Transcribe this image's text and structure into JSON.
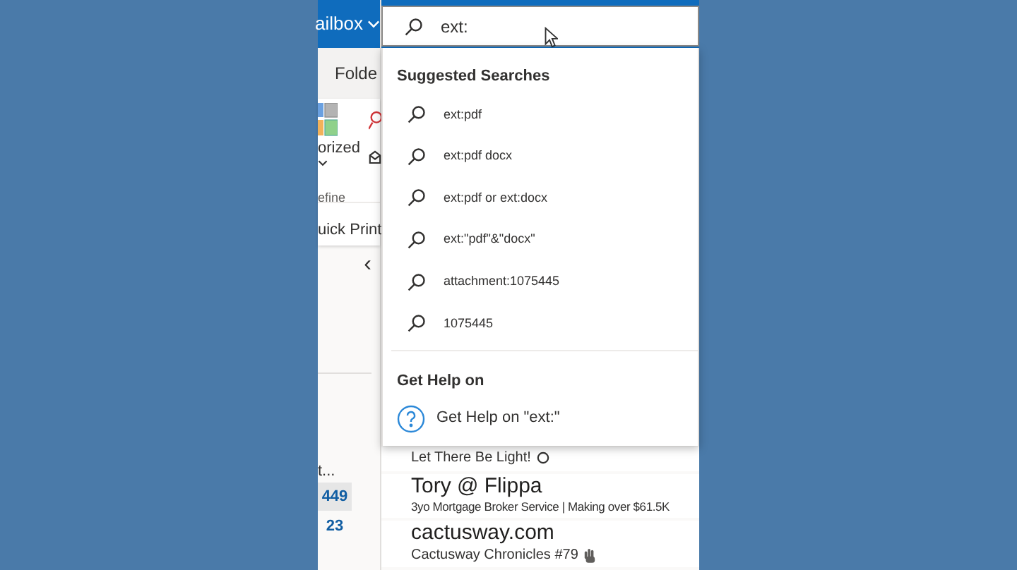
{
  "header": {
    "mailbox_label": "ailbox"
  },
  "search": {
    "value": "ext:"
  },
  "ribbon": {
    "tab": "Folde",
    "categorize_label": "orized",
    "group_label": "efine",
    "quick_print": "uick Print"
  },
  "nav": {
    "collapse": "‹",
    "truncated_item": "t...",
    "counts": [
      {
        "count": "449",
        "selected": true
      },
      {
        "count": "23",
        "selected": false
      }
    ]
  },
  "suggestions": {
    "heading": "Suggested Searches",
    "items": [
      "ext:pdf",
      "ext:pdf docx",
      "ext:pdf or ext:docx",
      "ext:\"pdf\"&\"docx\"",
      "attachment:1075445",
      "1075445"
    ]
  },
  "help": {
    "heading": "Get Help on",
    "item": "Get Help on \"ext:\""
  },
  "messages": [
    {
      "preview": "Let There Be Light!",
      "kind": "marked"
    },
    {
      "sender": "Tory @ Flippa",
      "preview": "3yo Mortgage Broker Service | Making over $61.5K",
      "kind": "plain"
    },
    {
      "sender": "cactusway.com",
      "preview": "Cactusway Chronicles #79",
      "kind": "reacted"
    }
  ]
}
